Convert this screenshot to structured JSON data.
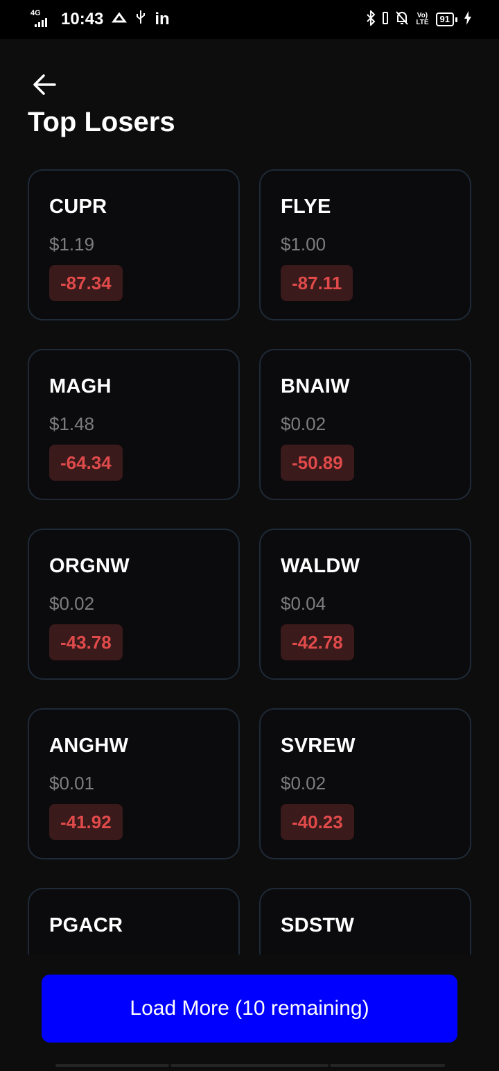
{
  "status_bar": {
    "network": "4G",
    "time": "10:43",
    "linkedin": "in",
    "volte": "VoLTE",
    "battery": "91"
  },
  "header": {
    "back_icon": "arrow-left-icon",
    "title": "Top Losers"
  },
  "stocks": [
    {
      "symbol": "CUPR",
      "price": "$1.19",
      "change": "-87.34"
    },
    {
      "symbol": "FLYE",
      "price": "$1.00",
      "change": "-87.11"
    },
    {
      "symbol": "MAGH",
      "price": "$1.48",
      "change": "-64.34"
    },
    {
      "symbol": "BNAIW",
      "price": "$0.02",
      "change": "-50.89"
    },
    {
      "symbol": "ORGNW",
      "price": "$0.02",
      "change": "-43.78"
    },
    {
      "symbol": "WALDW",
      "price": "$0.04",
      "change": "-42.78"
    },
    {
      "symbol": "ANGHW",
      "price": "$0.01",
      "change": "-41.92"
    },
    {
      "symbol": "SVREW",
      "price": "$0.02",
      "change": "-40.23"
    },
    {
      "symbol": "PGACR",
      "price": "",
      "change": ""
    },
    {
      "symbol": "SDSTW",
      "price": "",
      "change": ""
    }
  ],
  "load_more": {
    "label": "Load More (10 remaining)"
  },
  "colors": {
    "accent": "#0000ff",
    "loss_text": "#e04a4a",
    "loss_bg": "#3a1a1b",
    "card_border": "#1f2a38"
  }
}
